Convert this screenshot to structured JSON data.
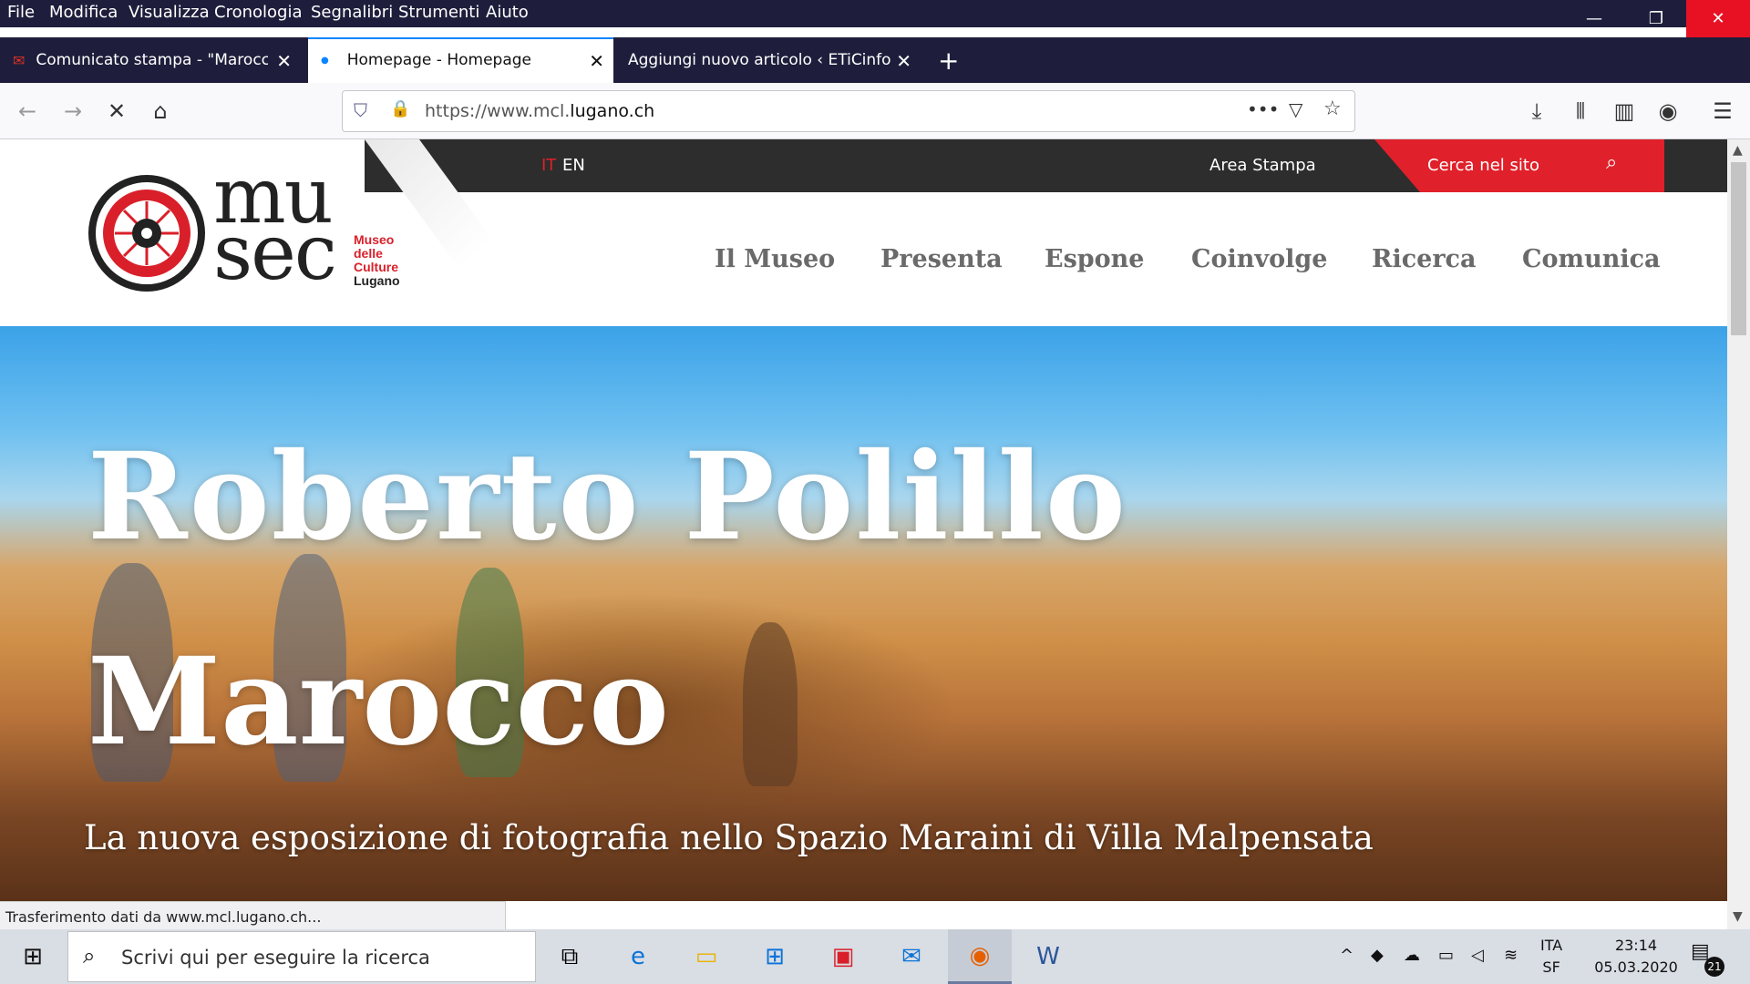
{
  "menubar": {
    "items": [
      "File",
      "Modifica",
      "Visualizza",
      "Cronologia",
      "Segnalibri",
      "Strumenti",
      "Aiuto"
    ],
    "win_minimize": "—",
    "win_restore": "❐",
    "win_close": "✕"
  },
  "tabs": [
    {
      "title": "Comunicato stampa - \"Marocco\"",
      "icon": "gmail-icon"
    },
    {
      "title": "Homepage - Homepage",
      "icon": "loading-dot-icon",
      "active": true
    },
    {
      "title": "Aggiungi nuovo articolo ‹ ETiCinformazione",
      "icon": "wordpress-icon"
    }
  ],
  "new_tab": "+",
  "tab_close": "✕",
  "urlbar": {
    "prefix": "https://www.mcl.",
    "domain": "lugano.ch"
  },
  "site": {
    "lang_it": "IT",
    "lang_en": "EN",
    "area_stampa": "Area Stampa",
    "cerca": "Cerca nel sito",
    "logo": {
      "mu": "mu",
      "sec": "sec",
      "line1": "Museo",
      "line2": "delle",
      "line3": "Culture",
      "line4": "Lugano"
    },
    "nav": [
      "Il Museo",
      "Presenta",
      "Espone",
      "Coinvolge",
      "Ricerca",
      "Comunica"
    ],
    "hero": {
      "title1": "Roberto Polillo",
      "title2": "Marocco",
      "subtitle": "La nuova esposizione di fotografia nello Spazio Maraini di Villa Malpensata"
    }
  },
  "status_bar": "Trasferimento dati da www.mcl.lugano.ch...",
  "taskbar": {
    "search_placeholder": "Scrivi qui per eseguire la ricerca",
    "lang": "ITA",
    "layout": "SF",
    "time": "23:14",
    "date": "05.03.2020",
    "notifications": "21"
  },
  "colors": {
    "accent_red": "#e0202a",
    "dark_strip": "#2d2d2d",
    "chrome_dark": "#1e1e3c"
  }
}
